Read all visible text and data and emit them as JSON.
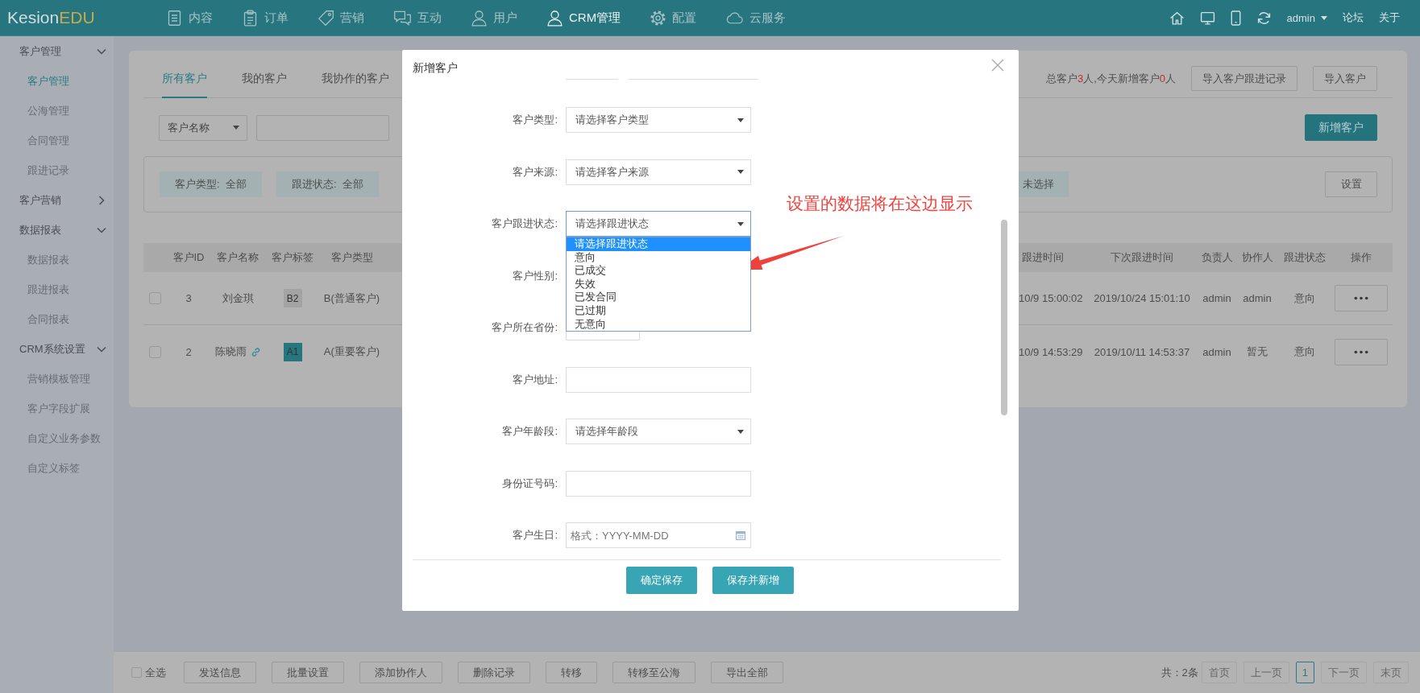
{
  "topbar": {
    "logo": {
      "brand": "Kesion",
      "suffix": "EDU"
    },
    "nav": [
      {
        "label": "内容",
        "selected": false
      },
      {
        "label": "订单",
        "selected": false
      },
      {
        "label": "营销",
        "selected": false
      },
      {
        "label": "互动",
        "selected": false
      },
      {
        "label": "用户",
        "selected": false
      },
      {
        "label": "CRM管理",
        "selected": true
      },
      {
        "label": "配置",
        "selected": false
      },
      {
        "label": "云服务",
        "selected": false
      }
    ],
    "user": "admin",
    "links": [
      "论坛",
      "关于"
    ]
  },
  "sidebar": {
    "groups": [
      {
        "label": "客户管理",
        "expanded": true,
        "items": [
          {
            "label": "客户管理",
            "selected": true
          },
          {
            "label": "公海管理",
            "selected": false
          },
          {
            "label": "合同管理",
            "selected": false
          },
          {
            "label": "跟进记录",
            "selected": false
          }
        ]
      },
      {
        "label": "客户营销",
        "expanded": false
      },
      {
        "label": "数据报表",
        "expanded": true,
        "items": [
          {
            "label": "数据报表",
            "selected": false
          },
          {
            "label": "跟进报表",
            "selected": false
          },
          {
            "label": "合同报表",
            "selected": false
          }
        ]
      },
      {
        "label": "CRM系统设置",
        "expanded": true,
        "items": [
          {
            "label": "营销模板管理",
            "selected": false
          },
          {
            "label": "客户字段扩展",
            "selected": false
          },
          {
            "label": "自定义业务参数",
            "selected": false
          },
          {
            "label": "自定义标签",
            "selected": false
          }
        ]
      }
    ]
  },
  "tabs": [
    {
      "label": "所有客户",
      "selected": true
    },
    {
      "label": "我的客户",
      "selected": false
    },
    {
      "label": "我协作的客户",
      "selected": false
    }
  ],
  "summary": [
    {
      "text": "总客户",
      "highlight": false
    },
    {
      "text": "3",
      "highlight": true
    },
    {
      "text": "人,今天新增客户",
      "highlight": false
    },
    {
      "text": "0",
      "highlight": true
    },
    {
      "text": "人",
      "highlight": false
    }
  ],
  "header_buttons": [
    "导入客户跟进记录",
    "导入客户"
  ],
  "search": {
    "field": "客户名称"
  },
  "add_button": "新增客户",
  "filters": [
    {
      "text": "客户类型:  全部"
    },
    {
      "text": "跟进状态:  全部"
    },
    {
      "text": "未选择"
    }
  ],
  "settings_button": "设置",
  "table": {
    "columns": [
      "客户ID",
      "客户名称",
      "客户标签",
      "客户类型",
      "跟进时间",
      "下次跟进时间",
      "负责人",
      "协作人",
      "跟进状态",
      "操作"
    ],
    "rows": [
      {
        "checked": false,
        "id": "3",
        "name": "刘金琪",
        "linked": false,
        "tag": {
          "label": "B2",
          "color": "#a3a3a3"
        },
        "type": "B(普通客户)",
        "column_5": "10/9 15:00:02",
        "next_follow_up": "2019/10/24 15:01:10",
        "owner": "admin",
        "collaborator": "admin",
        "status": "意向"
      },
      {
        "checked": false,
        "id": "2",
        "name": "陈晓雨",
        "linked": true,
        "tag": {
          "label": "A1",
          "color": "#26767f"
        },
        "type": "A(重要客户)",
        "column_5": "10/9 14:53:29",
        "next_follow_up": "2019/10/11 14:53:37",
        "owner": "admin",
        "collaborator": "暂无",
        "status": "意向"
      }
    ]
  },
  "bottom_bar": {
    "select_all": {
      "label": "全选",
      "checked": false
    },
    "buttons": [
      "发送信息",
      "批量设置",
      "添加协作人",
      "删除记录",
      "转移",
      "转移至公海",
      "导出全部"
    ],
    "total": "共：2条",
    "pages": [
      {
        "label": "首页",
        "selected": false,
        "disabled": true
      },
      {
        "label": "上一页",
        "selected": false,
        "disabled": true
      },
      {
        "label": "1",
        "selected": true,
        "disabled": false
      },
      {
        "label": "下一页",
        "selected": false,
        "disabled": true
      },
      {
        "label": "末页",
        "selected": false,
        "disabled": true
      }
    ]
  },
  "modal": {
    "title": "新增客户",
    "fields": [
      {
        "label": "客户类型:",
        "kind": "select",
        "value": "请选择客户类型",
        "expanded": false
      },
      {
        "label": "客户来源:",
        "kind": "select",
        "value": "请选择客户来源",
        "expanded": false
      },
      {
        "label": "客户跟进状态:",
        "kind": "select",
        "value": "请选择跟进状态",
        "expanded": true,
        "options": [
          {
            "label": "请选择跟进状态",
            "selected": true
          },
          {
            "label": "意向",
            "selected": false
          },
          {
            "label": "已成交",
            "selected": false
          },
          {
            "label": "失效",
            "selected": false
          },
          {
            "label": "已发合同",
            "selected": false
          },
          {
            "label": "已过期",
            "selected": false
          },
          {
            "label": "无意向",
            "selected": false
          }
        ]
      },
      {
        "label": "客户性别:",
        "kind": "covered"
      },
      {
        "label": "客户所在省份:",
        "kind": "short_select",
        "expanded": false
      },
      {
        "label": "客户地址:",
        "kind": "text"
      },
      {
        "label": "客户年龄段:",
        "kind": "select",
        "value": "请选择年龄段",
        "expanded": false
      },
      {
        "label": "身份证号码:",
        "kind": "text"
      },
      {
        "label": "客户生日:",
        "kind": "date",
        "placeholder": "格式：YYYY-MM-DD"
      }
    ],
    "buttons": [
      "确定保存",
      "保存并新增"
    ],
    "annotation": "设置的数据将在这边显示"
  }
}
